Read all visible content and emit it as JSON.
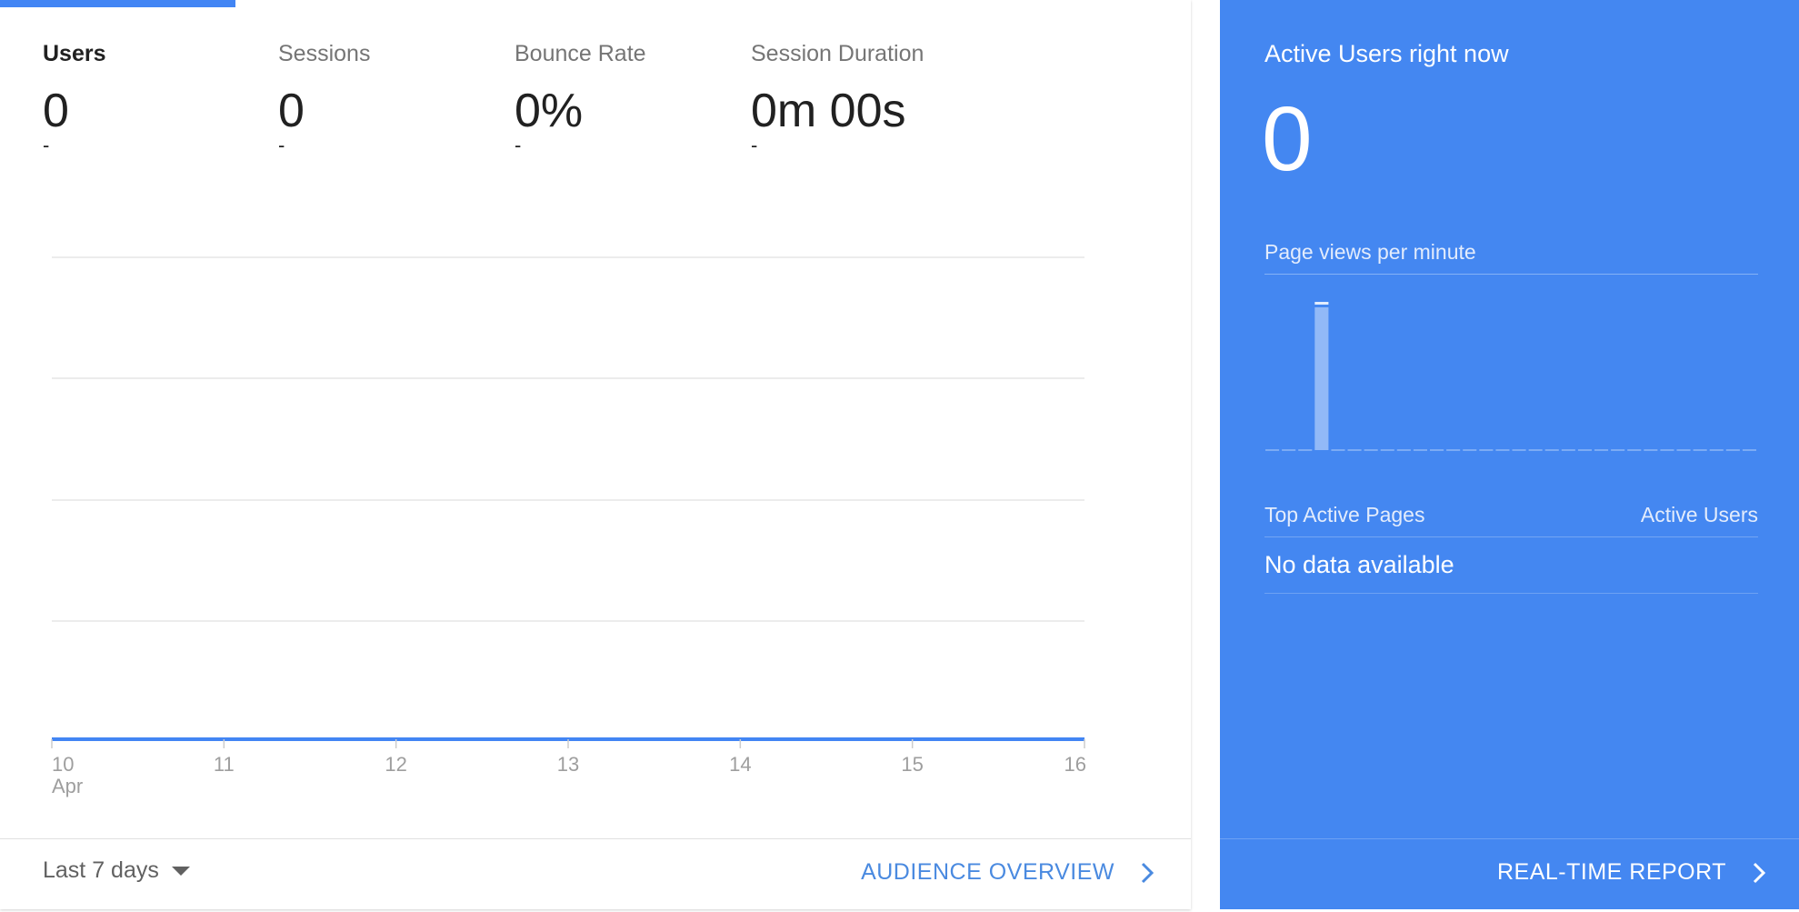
{
  "metrics": [
    {
      "label": "Users",
      "value": "0",
      "change": "-",
      "active": true
    },
    {
      "label": "Sessions",
      "value": "0",
      "change": "-",
      "active": false
    },
    {
      "label": "Bounce Rate",
      "value": "0%",
      "change": "-",
      "active": false
    },
    {
      "label": "Session Duration",
      "value": "0m 00s",
      "change": "-",
      "active": false
    }
  ],
  "chart_data": {
    "type": "line",
    "x": [
      "10",
      "11",
      "12",
      "13",
      "14",
      "15",
      "16"
    ],
    "x_sublabel": "Apr",
    "series": [
      {
        "values": [
          0,
          0,
          0,
          0,
          0,
          0,
          0
        ]
      }
    ],
    "grid": true,
    "color": "#4285f4"
  },
  "footer_left": {
    "range_label": "Last 7 days",
    "audience_link": "AUDIENCE OVERVIEW"
  },
  "realtime": {
    "title": "Active Users right now",
    "count": "0",
    "pvm_label": "Page views per minute",
    "pvm_bars": [
      0,
      0,
      0,
      1,
      0,
      0,
      0,
      0,
      0,
      0,
      0,
      0,
      0,
      0,
      0,
      0,
      0,
      0,
      0,
      0,
      0,
      0,
      0,
      0,
      0,
      0,
      0,
      0,
      0,
      0
    ],
    "top_pages_header": "Top Active Pages",
    "active_users_header": "Active Users",
    "empty_text": "No data available",
    "report_link": "REAL-TIME REPORT"
  },
  "colors": {
    "accent": "#4285f4",
    "realtime_bg": "#4487f1"
  }
}
